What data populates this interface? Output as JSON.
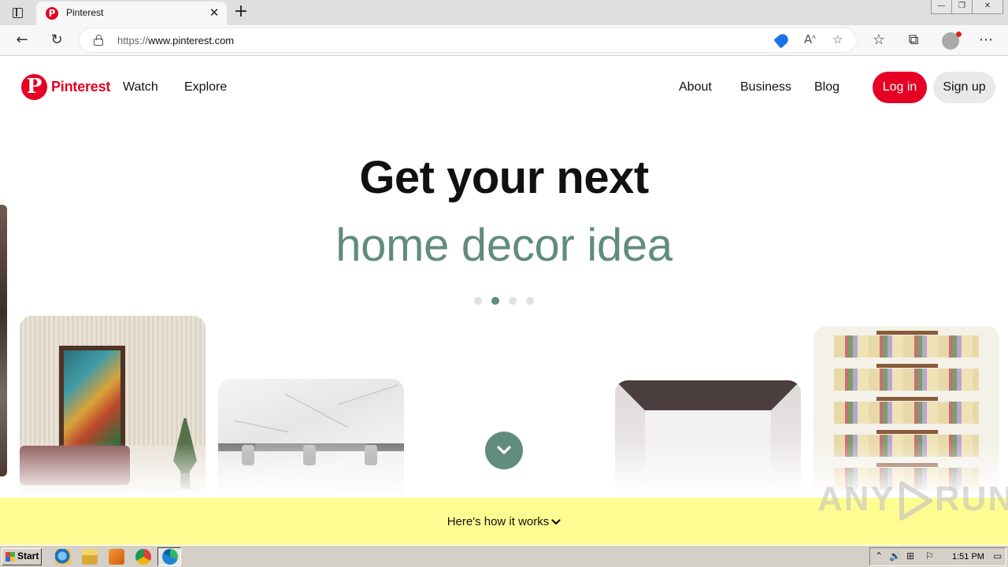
{
  "browser": {
    "tab": {
      "title": "Pinterest",
      "favicon": "pinterest-logo",
      "close_glyph": "✕"
    },
    "new_tab_glyph": "+",
    "address": {
      "scheme": "https://",
      "host": "www.pinterest.com"
    },
    "icons": [
      "sidebar-icon",
      "back-icon",
      "reload-icon",
      "lock-icon",
      "tag-icon",
      "read-aloud-icon",
      "add-favorite-icon",
      "favorites-icon",
      "collections-icon",
      "profile-icon",
      "more-icon"
    ]
  },
  "nav": {
    "brand": "Pinterest",
    "left_links": [
      "Watch",
      "Explore"
    ],
    "right_links": [
      "About",
      "Business",
      "Blog"
    ],
    "login_label": "Log in",
    "signup_label": "Sign up"
  },
  "hero": {
    "headline": "Get your next",
    "subheadline": "home decor idea",
    "carousel": {
      "count": 4,
      "active_index": 1
    },
    "accent_color": "#618c7b"
  },
  "banner": {
    "text": "Here's how it works",
    "background": "#fffd92"
  },
  "watermark": {
    "left": "ANY",
    "right": "RUN"
  },
  "taskbar": {
    "start_label": "Start",
    "apps": [
      "internet-explorer-icon",
      "file-explorer-icon",
      "media-player-icon",
      "chrome-icon",
      "edge-icon"
    ],
    "clock": "1:51 PM"
  },
  "colors": {
    "brand": "#e60023",
    "accent": "#618c7b"
  }
}
